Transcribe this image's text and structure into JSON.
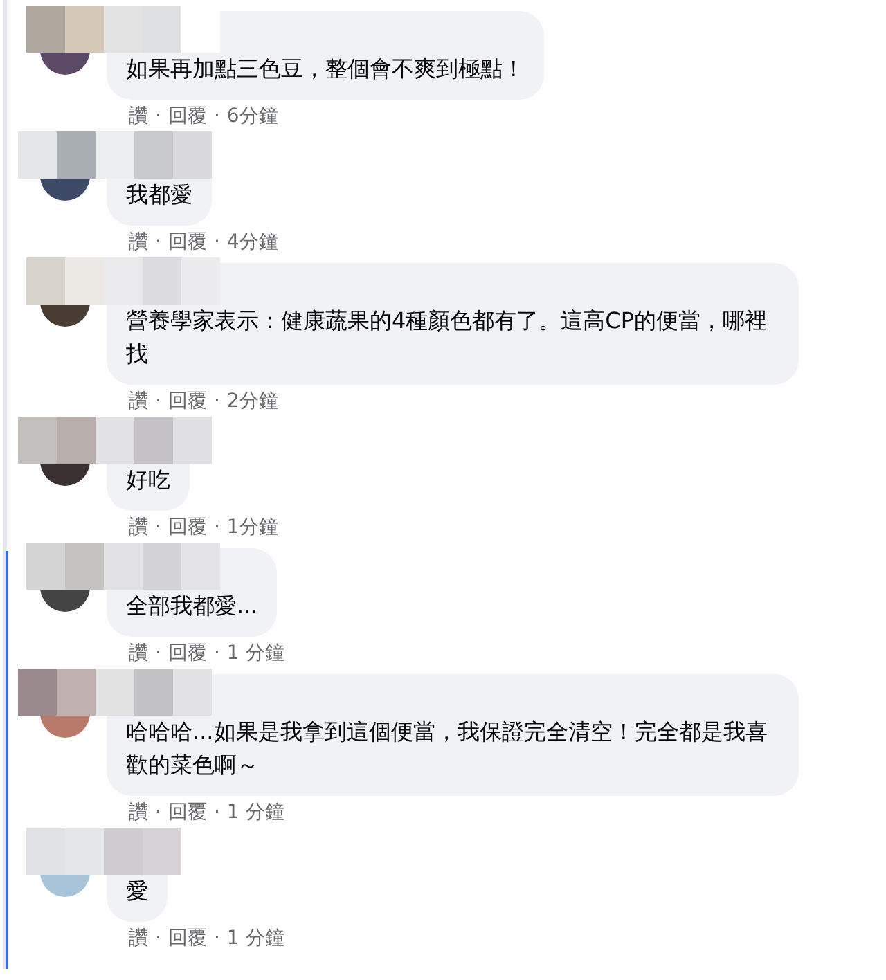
{
  "comments": [
    {
      "text": "如果再加點三色豆，整個會不爽到極點！",
      "actions": [
        "讚",
        "回覆",
        "6分鐘"
      ],
      "separator": "·"
    },
    {
      "text": "我都愛",
      "actions": [
        "讚",
        "回覆",
        "4分鐘"
      ],
      "separator": "·"
    },
    {
      "text": "營養學家表示：健康蔬果的4種顏色都有了。這高CP的便當，哪裡找",
      "actions": [
        "讚",
        "回覆",
        "2分鐘"
      ],
      "separator": "·"
    },
    {
      "text": "好吃",
      "actions": [
        "讚",
        "回覆",
        "1分鐘"
      ],
      "separator": "·"
    },
    {
      "text": "全部我都愛...",
      "actions": [
        "讚",
        "回覆",
        "1 分鐘"
      ],
      "separator": "·"
    },
    {
      "text": "哈哈哈...如果是我拿到這個便當，我保證完全清空！完全都是我喜歡的菜色啊～",
      "actions": [
        "讚",
        "回覆",
        "1 分鐘"
      ],
      "separator": "·"
    },
    {
      "text": "愛",
      "actions": [
        "讚",
        "回覆",
        "1 分鐘"
      ],
      "separator": "·"
    }
  ]
}
